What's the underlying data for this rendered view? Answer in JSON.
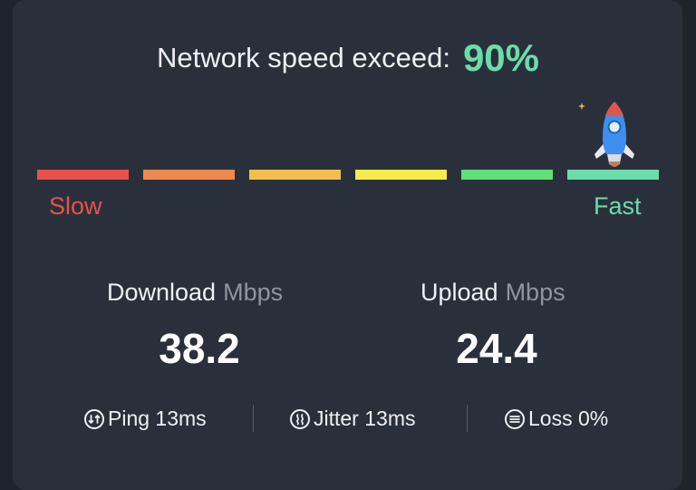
{
  "headline": {
    "label": "Network speed exceed:",
    "value": "90%"
  },
  "speed_scale": {
    "progress": 0.9,
    "segments": [
      "#e8524c",
      "#ef8a4e",
      "#f2bf4e",
      "#f6ec4c",
      "#5ee077",
      "#6cdcaa"
    ],
    "slow_label": "Slow",
    "fast_label": "Fast"
  },
  "download": {
    "label": "Download",
    "unit": "Mbps",
    "value": "38.2"
  },
  "upload": {
    "label": "Upload",
    "unit": "Mbps",
    "value": "24.4"
  },
  "metrics": {
    "ping": {
      "icon": "ping-icon",
      "text": "Ping 13ms"
    },
    "jitter": {
      "icon": "jitter-icon",
      "text": "Jitter 13ms"
    },
    "loss": {
      "icon": "loss-icon",
      "text": "Loss 0%"
    }
  },
  "colors": {
    "background": "#2a303b",
    "accent": "#6cdcaa",
    "slow": "#e8524c",
    "text": "#eef0f3",
    "muted": "#8f959e"
  }
}
